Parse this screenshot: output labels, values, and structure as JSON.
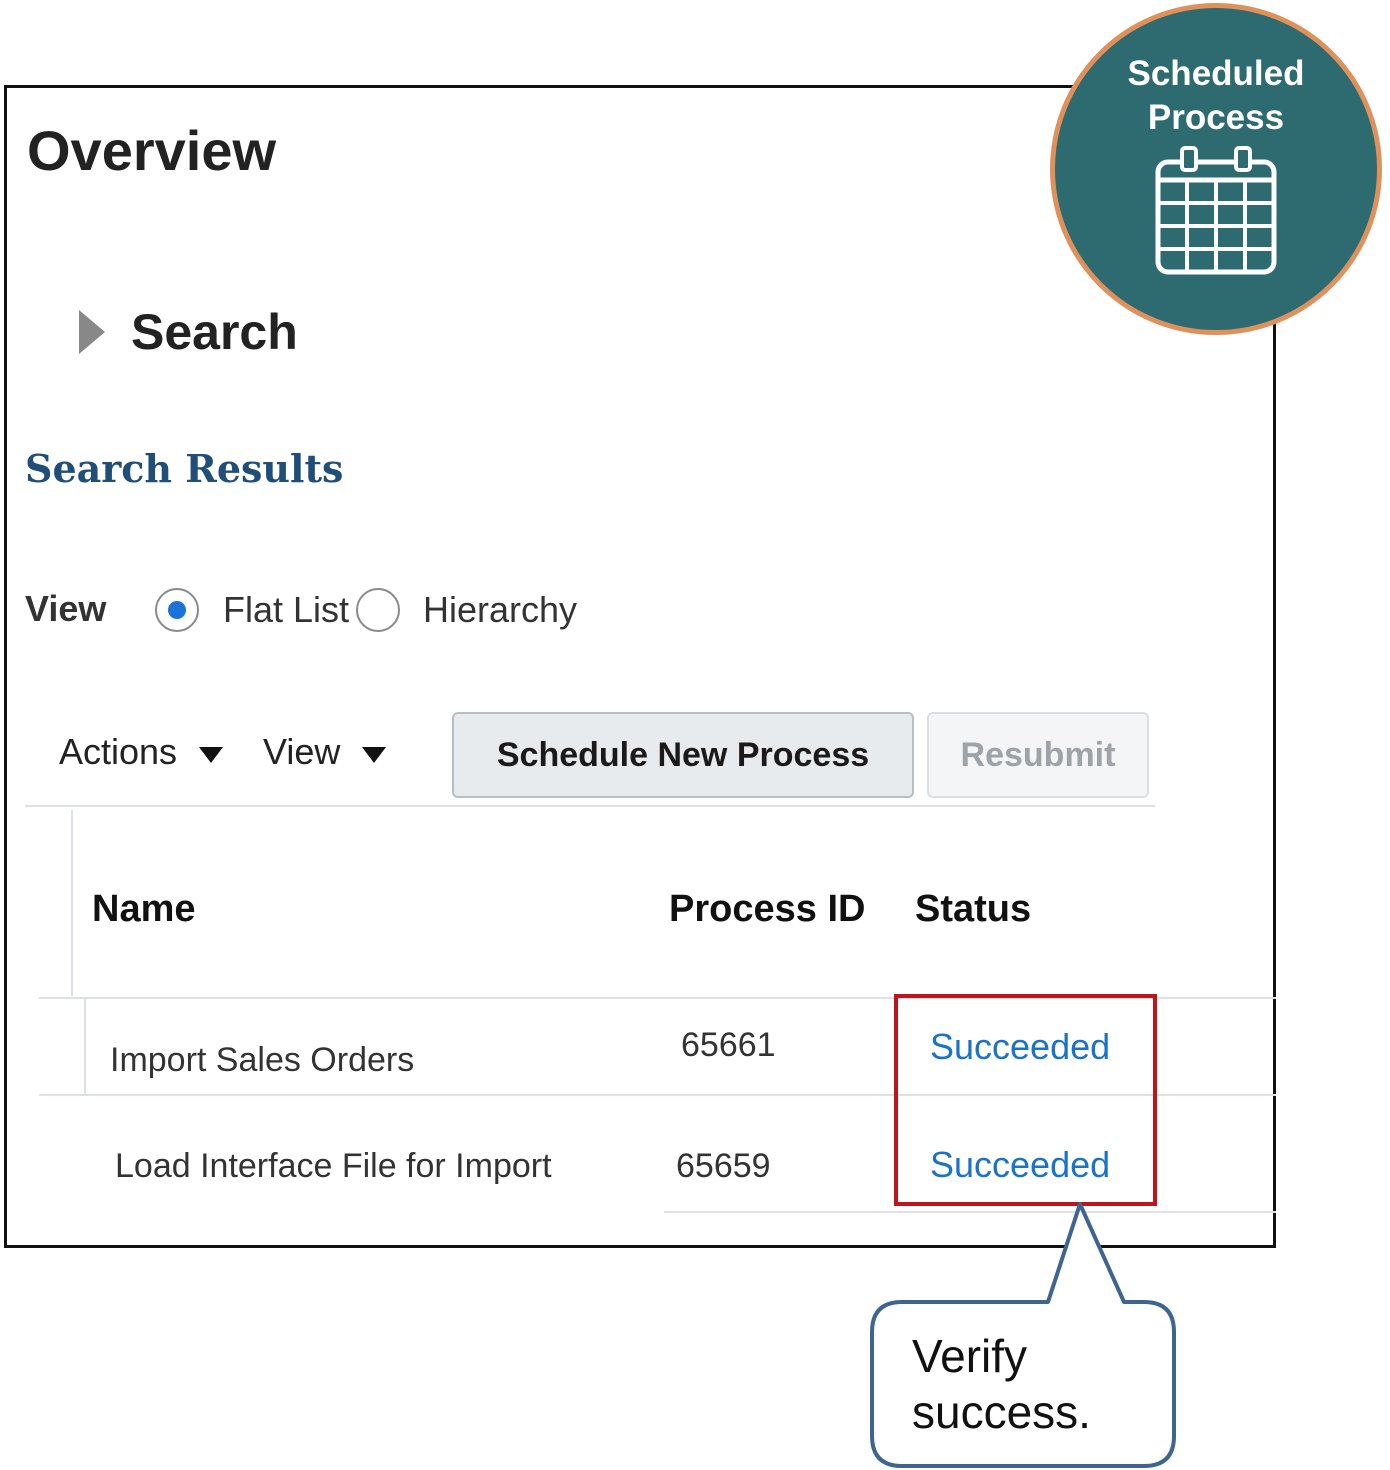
{
  "page": {
    "title": "Overview",
    "search_section": "Search",
    "results_title": "Search Results"
  },
  "view_toggle": {
    "label": "View",
    "options": [
      {
        "label": "Flat List",
        "selected": true
      },
      {
        "label": "Hierarchy",
        "selected": false
      }
    ]
  },
  "toolbar": {
    "actions_label": "Actions",
    "view_label": "View",
    "schedule_label": "Schedule New Process",
    "resubmit_label": "Resubmit"
  },
  "table": {
    "columns": [
      "Name",
      "Process ID",
      "Status"
    ],
    "rows": [
      {
        "name": "Import Sales Orders",
        "process_id": "65661",
        "status": "Succeeded"
      },
      {
        "name": "Load Interface File for Import",
        "process_id": "65659",
        "status": "Succeeded"
      }
    ]
  },
  "badge": {
    "line1": "Scheduled",
    "line2": "Process",
    "icon": "calendar-icon"
  },
  "callout": {
    "line1": "Verify",
    "line2": "success."
  },
  "colors": {
    "badge_fill": "#2e6b70",
    "badge_ring": "#e0915b",
    "highlight": "#c0141c",
    "link": "#1a73c8",
    "callout_border": "#3d6590"
  }
}
